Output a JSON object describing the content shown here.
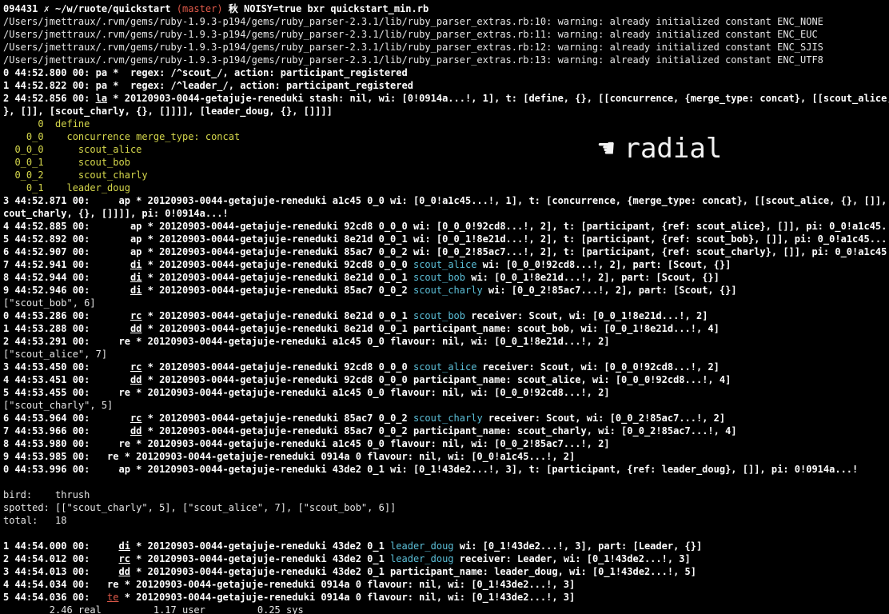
{
  "colors": {
    "background": "#000000",
    "text": "#e6e6e6",
    "yellow": "#d6d84c",
    "cyan": "#5cbfd8",
    "red": "#e05a4a"
  },
  "overlay": {
    "hand_icon": "pointing-hand-icon",
    "text": "radial"
  },
  "lines": [
    [
      [
        "wb",
        "094431 ✗ ~/w/ruote/quickstart "
      ],
      [
        "r",
        "(master)"
      ],
      [
        "wb",
        " 秋 NOISY=true bxr quickstart_min.rb"
      ]
    ],
    [
      [
        "w",
        "/Users/jmettraux/.rvm/gems/ruby-1.9.3-p194/gems/ruby_parser-2.3.1/lib/ruby_parser_extras.rb:10: warning: already initialized constant ENC_NONE"
      ]
    ],
    [
      [
        "w",
        "/Users/jmettraux/.rvm/gems/ruby-1.9.3-p194/gems/ruby_parser-2.3.1/lib/ruby_parser_extras.rb:11: warning: already initialized constant ENC_EUC"
      ]
    ],
    [
      [
        "w",
        "/Users/jmettraux/.rvm/gems/ruby-1.9.3-p194/gems/ruby_parser-2.3.1/lib/ruby_parser_extras.rb:12: warning: already initialized constant ENC_SJIS"
      ]
    ],
    [
      [
        "w",
        "/Users/jmettraux/.rvm/gems/ruby-1.9.3-p194/gems/ruby_parser-2.3.1/lib/ruby_parser_extras.rb:13: warning: already initialized constant ENC_UTF8"
      ]
    ],
    [
      [
        "wb",
        "0 44:52.800 00: pa *  regex: /^scout_/, action: participant_registered"
      ]
    ],
    [
      [
        "wb",
        "1 44:52.822 00: pa *  regex: /^leader_/, action: participant_registered"
      ]
    ],
    [
      [
        "wb",
        "2 44:52.856 00: "
      ],
      [
        "wb u",
        "la"
      ],
      [
        "wb",
        " * 20120903-0044-getajuje-reneduki stash: nil, wi: [0!0914a...!, 1], t: [define, {}, [[concurrence, {merge_type: concat}, [[scout_alice, {}, [], [scout_bob, {}, []], [scout_charly, {}, []]]], [leader_doug, {}, []]]]"
      ]
    ],
    [
      [
        "wb",
        "}, []], [scout_charly, {}, []]]], [leader_doug, {}, []]]]"
      ]
    ],
    [
      [
        "y",
        "      0  define"
      ]
    ],
    [
      [
        "y",
        "    0_0    concurrence merge_type: concat"
      ]
    ],
    [
      [
        "y",
        "  0_0_0      scout_alice"
      ]
    ],
    [
      [
        "y",
        "  0_0_1      scout_bob"
      ]
    ],
    [
      [
        "y",
        "  0_0_2      scout_charly"
      ]
    ],
    [
      [
        "y",
        "    0_1    leader_doug"
      ]
    ],
    [
      [
        "wb",
        "3 44:52.871 00:     ap * 20120903-0044-getajuje-reneduki a1c45 0_0 wi: [0_0!a1c45...!, 1], t: [concurrence, {merge_type: concat}, [[scout_alice, {}, []], [scout_bob, {}, []], [scout_charly, {}, []]]], pi: 0!0914a...!"
      ]
    ],
    [
      [
        "wb",
        "cout_charly, {}, []]]], pi: 0!0914a...!"
      ]
    ],
    [
      [
        "wb",
        "4 44:52.885 00:       ap * 20120903-0044-getajuje-reneduki 92cd8 0_0_0 wi: [0_0_0!92cd8...!, 2], t: [participant, {ref: scout_alice}, []], pi: 0_0!a1c45...!"
      ]
    ],
    [
      [
        "wb",
        "5 44:52.892 00:       ap * 20120903-0044-getajuje-reneduki 8e21d 0_0_1 wi: [0_0_1!8e21d...!, 2], t: [participant, {ref: scout_bob}, []], pi: 0_0!a1c45...!"
      ]
    ],
    [
      [
        "wb",
        "6 44:52.907 00:       ap * 20120903-0044-getajuje-reneduki 85ac7 0_0_2 wi: [0_0_2!85ac7...!, 2], t: [participant, {ref: scout_charly}, []], pi: 0_0!a1c45...!"
      ]
    ],
    [
      [
        "wb",
        "7 44:52.941 00:       "
      ],
      [
        "wb u",
        "di"
      ],
      [
        "wb",
        " * 20120903-0044-getajuje-reneduki 92cd8 0_0_0 "
      ],
      [
        "c",
        "scout_alice"
      ],
      [
        "wb",
        " wi: [0_0_0!92cd8...!, 2], part: [Scout, {}]"
      ]
    ],
    [
      [
        "wb",
        "8 44:52.944 00:       "
      ],
      [
        "wb u",
        "di"
      ],
      [
        "wb",
        " * 20120903-0044-getajuje-reneduki 8e21d 0_0_1 "
      ],
      [
        "c",
        "scout_bob"
      ],
      [
        "wb",
        " wi: [0_0_1!8e21d...!, 2], part: [Scout, {}]"
      ]
    ],
    [
      [
        "wb",
        "9 44:52.946 00:       "
      ],
      [
        "wb u",
        "di"
      ],
      [
        "wb",
        " * 20120903-0044-getajuje-reneduki 85ac7 0_0_2 "
      ],
      [
        "c",
        "scout_charly"
      ],
      [
        "wb",
        " wi: [0_0_2!85ac7...!, 2], part: [Scout, {}]"
      ]
    ],
    [
      [
        "w",
        "[\"scout_bob\", 6]"
      ]
    ],
    [
      [
        "wb",
        "0 44:53.286 00:       "
      ],
      [
        "wb u",
        "rc"
      ],
      [
        "wb",
        " * 20120903-0044-getajuje-reneduki 8e21d 0_0_1 "
      ],
      [
        "c",
        "scout_bob"
      ],
      [
        "wb",
        " receiver: Scout, wi: [0_0_1!8e21d...!, 2]"
      ]
    ],
    [
      [
        "wb",
        "1 44:53.288 00:       "
      ],
      [
        "wb u",
        "dd"
      ],
      [
        "wb",
        " * 20120903-0044-getajuje-reneduki 8e21d 0_0_1 participant_name: scout_bob, wi: [0_0_1!8e21d...!, 4]"
      ]
    ],
    [
      [
        "wb",
        "2 44:53.291 00:     re * 20120903-0044-getajuje-reneduki a1c45 0_0 flavour: nil, wi: [0_0_1!8e21d...!, 2]"
      ]
    ],
    [
      [
        "w",
        "[\"scout_alice\", 7]"
      ]
    ],
    [
      [
        "wb",
        "3 44:53.450 00:       "
      ],
      [
        "wb u",
        "rc"
      ],
      [
        "wb",
        " * 20120903-0044-getajuje-reneduki 92cd8 0_0_0 "
      ],
      [
        "c",
        "scout_alice"
      ],
      [
        "wb",
        " receiver: Scout, wi: [0_0_0!92cd8...!, 2]"
      ]
    ],
    [
      [
        "wb",
        "4 44:53.451 00:       "
      ],
      [
        "wb u",
        "dd"
      ],
      [
        "wb",
        " * 20120903-0044-getajuje-reneduki 92cd8 0_0_0 participant_name: scout_alice, wi: [0_0_0!92cd8...!, 4]"
      ]
    ],
    [
      [
        "wb",
        "5 44:53.455 00:     re * 20120903-0044-getajuje-reneduki a1c45 0_0 flavour: nil, wi: [0_0_0!92cd8...!, 2]"
      ]
    ],
    [
      [
        "w",
        "[\"scout_charly\", 5]"
      ]
    ],
    [
      [
        "wb",
        "6 44:53.964 00:       "
      ],
      [
        "wb u",
        "rc"
      ],
      [
        "wb",
        " * 20120903-0044-getajuje-reneduki 85ac7 0_0_2 "
      ],
      [
        "c",
        "scout_charly"
      ],
      [
        "wb",
        " receiver: Scout, wi: [0_0_2!85ac7...!, 2]"
      ]
    ],
    [
      [
        "wb",
        "7 44:53.966 00:       "
      ],
      [
        "wb u",
        "dd"
      ],
      [
        "wb",
        " * 20120903-0044-getajuje-reneduki 85ac7 0_0_2 participant_name: scout_charly, wi: [0_0_2!85ac7...!, 4]"
      ]
    ],
    [
      [
        "wb",
        "8 44:53.980 00:     re * 20120903-0044-getajuje-reneduki a1c45 0_0 flavour: nil, wi: [0_0_2!85ac7...!, 2]"
      ]
    ],
    [
      [
        "wb",
        "9 44:53.985 00:   re * 20120903-0044-getajuje-reneduki 0914a 0 flavour: nil, wi: [0_0!a1c45...!, 2]"
      ]
    ],
    [
      [
        "wb",
        "0 44:53.996 00:     ap * 20120903-0044-getajuje-reneduki 43de2 0_1 wi: [0_1!43de2...!, 3], t: [participant, {ref: leader_doug}, []], pi: 0!0914a...!"
      ]
    ],
    [
      [
        "w",
        ""
      ]
    ],
    [
      [
        "w",
        "bird:    thrush"
      ]
    ],
    [
      [
        "w",
        "spotted: [[\"scout_charly\", 5], [\"scout_alice\", 7], [\"scout_bob\", 6]]"
      ]
    ],
    [
      [
        "w",
        "total:   18"
      ]
    ],
    [
      [
        "w",
        ""
      ]
    ],
    [
      [
        "wb",
        "1 44:54.000 00:     "
      ],
      [
        "wb u",
        "di"
      ],
      [
        "wb",
        " * 20120903-0044-getajuje-reneduki 43de2 0_1 "
      ],
      [
        "c",
        "leader_doug"
      ],
      [
        "wb",
        " wi: [0_1!43de2...!, 3], part: [Leader, {}]"
      ]
    ],
    [
      [
        "wb",
        "2 44:54.012 00:     "
      ],
      [
        "wb u",
        "rc"
      ],
      [
        "wb",
        " * 20120903-0044-getajuje-reneduki 43de2 0_1 "
      ],
      [
        "c",
        "leader_doug"
      ],
      [
        "wb",
        " receiver: Leader, wi: [0_1!43de2...!, 3]"
      ]
    ],
    [
      [
        "wb",
        "3 44:54.013 00:     "
      ],
      [
        "wb u",
        "dd"
      ],
      [
        "wb",
        " * 20120903-0044-getajuje-reneduki 43de2 0_1 participant_name: leader_doug, wi: [0_1!43de2...!, 5]"
      ]
    ],
    [
      [
        "wb",
        "4 44:54.034 00:   re * 20120903-0044-getajuje-reneduki 0914a 0 flavour: nil, wi: [0_1!43de2...!, 3]"
      ]
    ],
    [
      [
        "wb",
        "5 44:54.036 00:   "
      ],
      [
        "r u",
        "te"
      ],
      [
        "wb",
        " * 20120903-0044-getajuje-reneduki 0914a 0 flavour: nil, wi: [0_1!43de2...!, 3]"
      ]
    ],
    [
      [
        "w",
        "        2.46 real         1.17 user         0.25 sys"
      ]
    ]
  ]
}
